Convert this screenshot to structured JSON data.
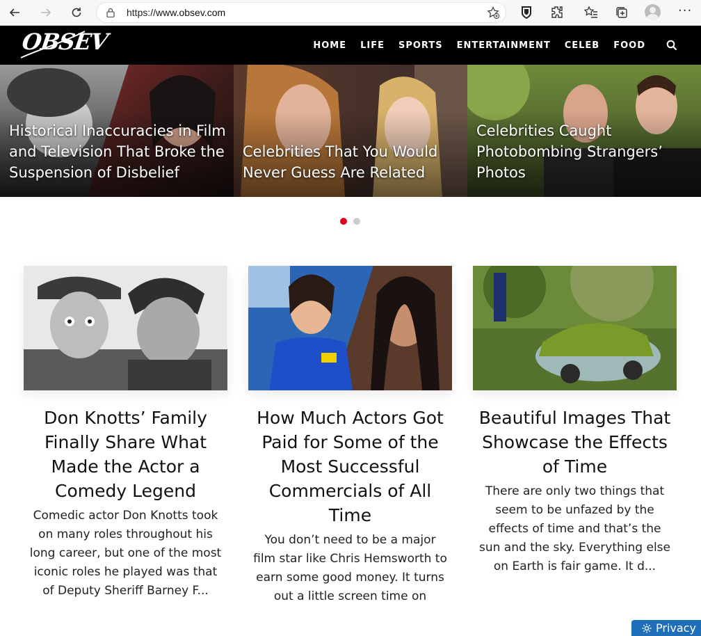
{
  "browser": {
    "url_scheme": "https://",
    "url_host": "www.obsev.com"
  },
  "site": {
    "logo_text": "OBSEV",
    "nav": [
      "HOME",
      "LIFE",
      "SPORTS",
      "ENTERTAINMENT",
      "CELEB",
      "FOOD"
    ]
  },
  "hero": {
    "slides": [
      {
        "title": "Historical Inaccuracies in Film and Television That Broke the Suspension of Disbelief"
      },
      {
        "title": "Celebrities That You Would Never Guess Are Related"
      },
      {
        "title": "Celebrities Caught Photobombing Strangers’ Photos"
      }
    ],
    "active_dot": 0
  },
  "cards": [
    {
      "title": "Don Knotts’ Family Finally Share What Made the Actor a Comedy Legend",
      "excerpt": "Comedic actor Don Knotts took on many roles throughout his long career, but one of the most iconic roles he played was that of Deputy Sheriff Barney F..."
    },
    {
      "title": "How Much Actors Got Paid for Some of the Most Successful Commercials of All Time",
      "excerpt": "You don’t need to be a major film star like Chris Hemsworth to earn some good money. It turns out a little screen time on"
    },
    {
      "title": "Beautiful Images That Showcase the Effects of Time",
      "excerpt": "There are only two things that seem to be unfazed by the effects of time and that’s the sun and the sky. Everything else on Earth is fair game. It d..."
    }
  ],
  "privacy_label": "Privacy",
  "colors": {
    "nav_bg": "#000000",
    "accent_dot": "#e0001b",
    "privacy_bg": "#1e6fb8"
  }
}
